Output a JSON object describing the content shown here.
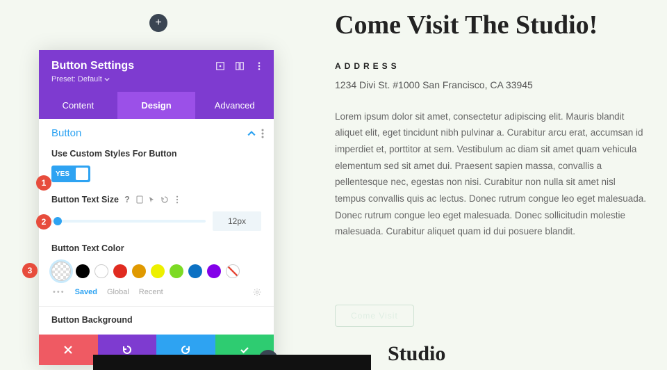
{
  "add_button_label": "+",
  "panel": {
    "title": "Button Settings",
    "preset": "Preset: Default",
    "tabs": [
      "Content",
      "Design",
      "Advanced"
    ],
    "active_tab": "Design",
    "section_title": "Button",
    "use_custom_label": "Use Custom Styles For Button",
    "toggle_yes": "YES",
    "text_size_label": "Button Text Size",
    "text_size_value": "12px",
    "text_color_label": "Button Text Color",
    "color_presets": [
      {
        "name": "transparent-selected",
        "hex": "checker",
        "selected": true
      },
      {
        "name": "black",
        "hex": "#000000"
      },
      {
        "name": "white",
        "hex": "#ffffff"
      },
      {
        "name": "red",
        "hex": "#e02b20"
      },
      {
        "name": "orange",
        "hex": "#e09900"
      },
      {
        "name": "yellow",
        "hex": "#edf000"
      },
      {
        "name": "green",
        "hex": "#7cda24"
      },
      {
        "name": "blue",
        "hex": "#0c71c3"
      },
      {
        "name": "purple",
        "hex": "#8300e9"
      },
      {
        "name": "none",
        "hex": "none"
      }
    ],
    "meta": {
      "saved": "Saved",
      "global": "Global",
      "recent": "Recent"
    },
    "bg_label": "Button Background"
  },
  "badges": [
    "1",
    "2",
    "3"
  ],
  "page": {
    "hero": "Come Visit The Studio!",
    "address_label": "ADDRESS",
    "address": "1234 Divi St. #1000 San Francisco, CA 33945",
    "lorem": "Lorem ipsum dolor sit amet, consectetur adipiscing elit. Mauris blandit aliquet elit, eget tincidunt nibh pulvinar a. Curabitur arcu erat, accumsan id imperdiet et, porttitor at sem. Vestibulum ac diam sit amet quam vehicula elementum sed sit amet dui. Praesent sapien massa, convallis a pellentesque nec, egestas non nisi. Curabitur non nulla sit amet nisl tempus convallis quis ac lectus. Donec rutrum congue leo eget malesuada. Donec rutrum congue leo eget malesuada. Donec sollicitudin molestie malesuada. Curabitur aliquet quam id dui posuere blandit.",
    "cta": "Come Visit",
    "studio": "Studio"
  }
}
